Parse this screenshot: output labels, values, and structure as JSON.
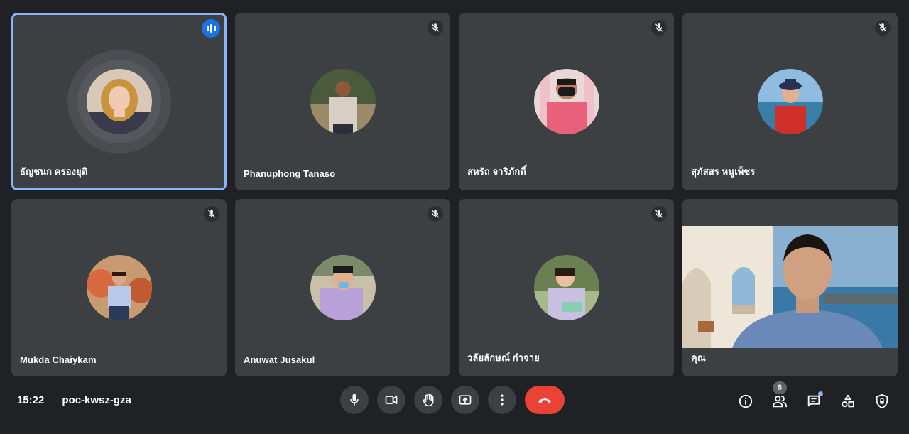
{
  "participants": [
    {
      "name": "ธัญชนก ครองยุติ",
      "status": "speaking"
    },
    {
      "name": "Phanuphong Tanaso",
      "status": "muted"
    },
    {
      "name": "สหรัถ จาริภักดิ์",
      "status": "muted"
    },
    {
      "name": "สุภัสสร หนูเพ็ชร",
      "status": "muted"
    },
    {
      "name": "Mukda Chaiykam",
      "status": "muted"
    },
    {
      "name": "Anuwat Jusakul",
      "status": "muted"
    },
    {
      "name": "วลัยลักษณ์ กำจาย",
      "status": "muted"
    },
    {
      "name": "คุณ",
      "status": "video"
    }
  ],
  "meeting": {
    "time": "15:22",
    "code": "poc-kwsz-gza"
  },
  "controls": {
    "mic": "microphone-icon",
    "camera": "camera-icon",
    "hand": "raise-hand-icon",
    "present": "present-screen-icon",
    "more": "more-options-icon",
    "hangup": "hang-up-icon"
  },
  "side_panel": {
    "info": "info-icon",
    "people": "people-icon",
    "people_count": "8",
    "chat": "chat-icon",
    "activities": "activities-icon",
    "host_controls": "host-controls-icon"
  },
  "colors": {
    "background": "#202124",
    "tile": "#3c4043",
    "speaking_border": "#8ab4f8",
    "speaking_badge": "#1a73e8",
    "hangup": "#ea4335"
  }
}
